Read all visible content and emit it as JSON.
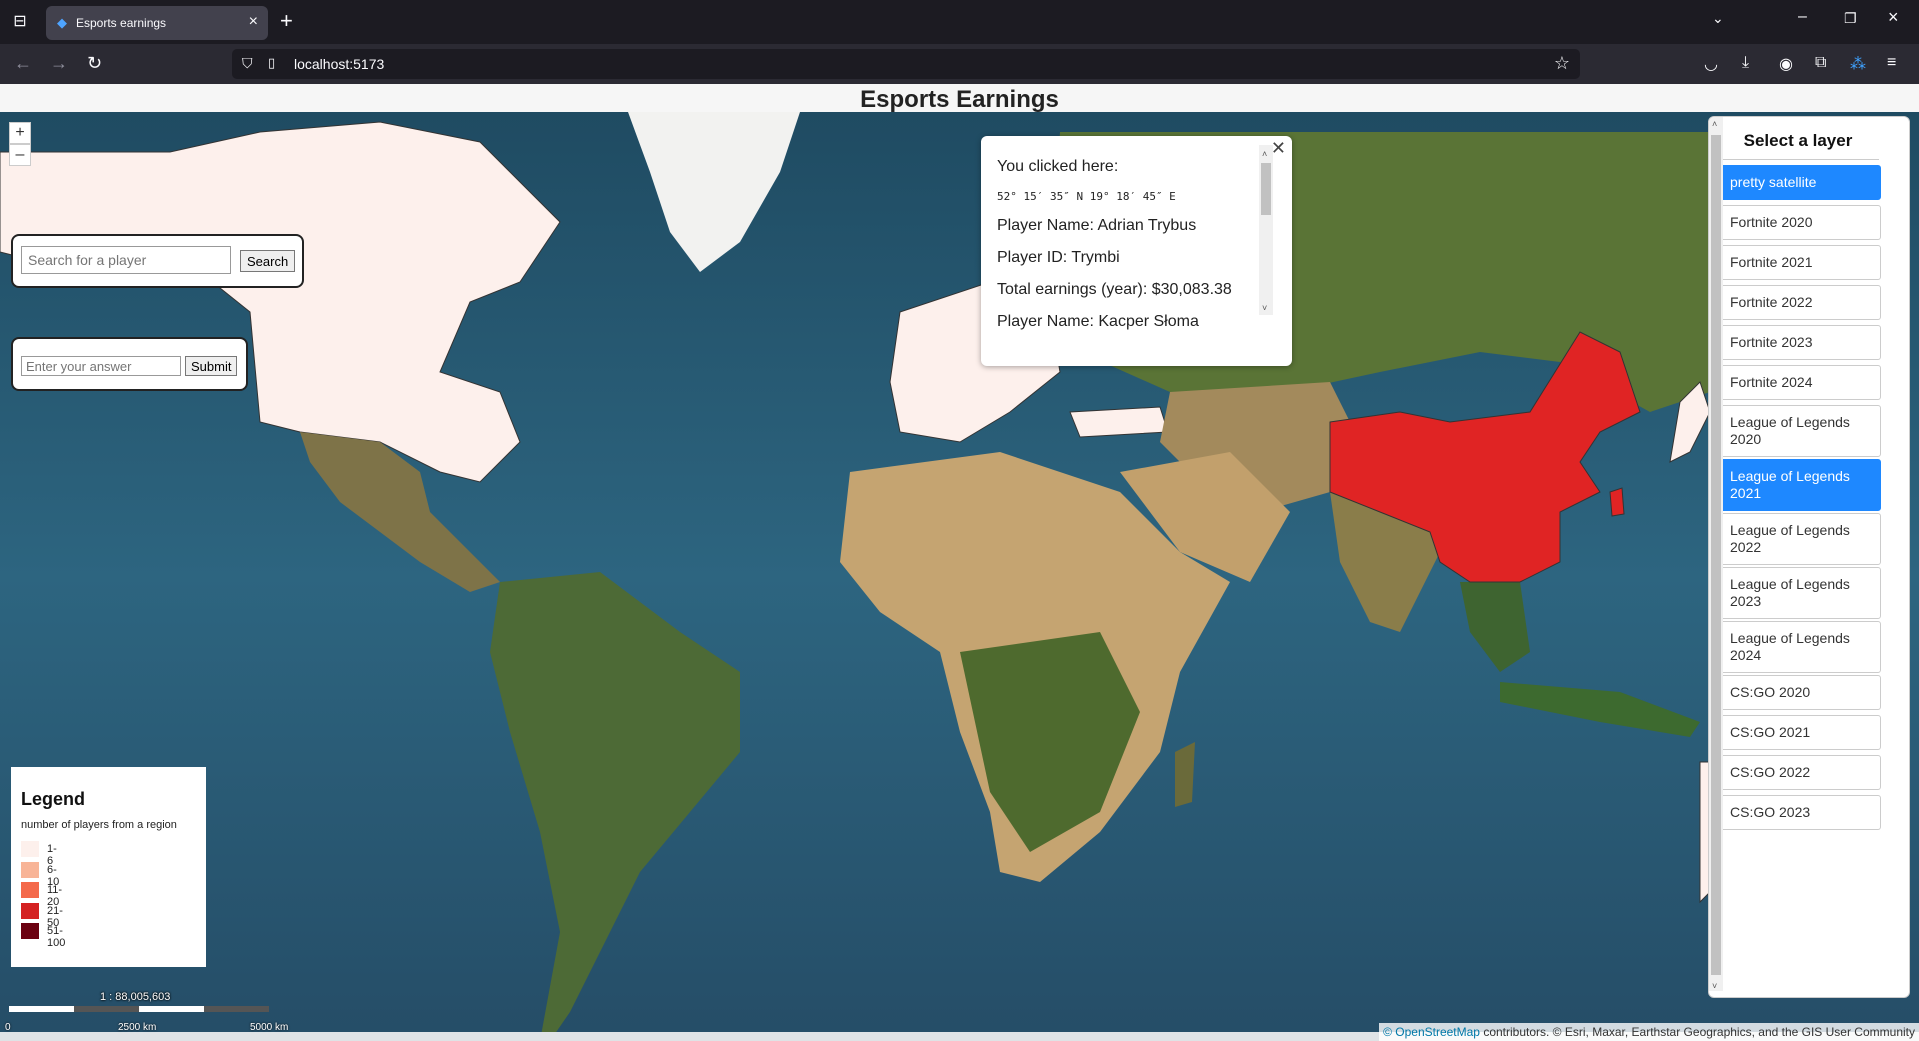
{
  "browser": {
    "tab_title": "Esports earnings",
    "url": "localhost:5173"
  },
  "page": {
    "title": "Esports Earnings"
  },
  "map_controls": {
    "zoom_in": "+",
    "zoom_out": "–"
  },
  "search": {
    "placeholder": "Search for a player",
    "button": "Search"
  },
  "answer": {
    "placeholder": "Enter your answer",
    "button": "Submit"
  },
  "popup": {
    "clicked_label": "You clicked here:",
    "coordinates": "52° 15′ 35″ N 19° 18′ 45″ E",
    "player_name_1": "Player Name: Adrian Trybus",
    "player_id_1": "Player ID: Trymbi",
    "earnings_1": "Total earnings (year): $30,083.38",
    "player_name_2": "Player Name: Kacper Słoma"
  },
  "layers": {
    "heading": "Select a layer",
    "items": [
      {
        "label": "pretty satellite",
        "active": true
      },
      {
        "label": "Fortnite 2020",
        "active": false
      },
      {
        "label": "Fortnite 2021",
        "active": false
      },
      {
        "label": "Fortnite 2022",
        "active": false
      },
      {
        "label": "Fortnite 2023",
        "active": false
      },
      {
        "label": "Fortnite 2024",
        "active": false
      },
      {
        "label": "League of Legends 2020",
        "active": false
      },
      {
        "label": "League of Legends 2021",
        "active": true
      },
      {
        "label": "League of Legends 2022",
        "active": false
      },
      {
        "label": "League of Legends 2023",
        "active": false
      },
      {
        "label": "League of Legends 2024",
        "active": false
      },
      {
        "label": "CS:GO 2020",
        "active": false
      },
      {
        "label": "CS:GO 2021",
        "active": false
      },
      {
        "label": "CS:GO 2022",
        "active": false
      },
      {
        "label": "CS:GO 2023",
        "active": false
      }
    ]
  },
  "legend": {
    "title": "Legend",
    "subtitle": "number of players from a region",
    "items": [
      {
        "label": "1-6",
        "color": "#fdf0ec"
      },
      {
        "label": "6-10",
        "color": "#f8b497"
      },
      {
        "label": "11-20",
        "color": "#f4694a"
      },
      {
        "label": "21-50",
        "color": "#d42121"
      },
      {
        "label": "51-100",
        "color": "#6b0010"
      }
    ]
  },
  "scale": {
    "ratio": "1 : 88,005,603",
    "label_start": "0",
    "label_mid": "2500 km",
    "label_end": "5000 km"
  },
  "attribution": {
    "osm": "© OpenStreetMap",
    "rest": " contributors. © Esri, Maxar, Earthstar Geographics, and the GIS User Community"
  },
  "colors": {
    "accent": "#1e88ff",
    "highlight_region": "#e02424",
    "low_region": "#fdf0ec"
  }
}
